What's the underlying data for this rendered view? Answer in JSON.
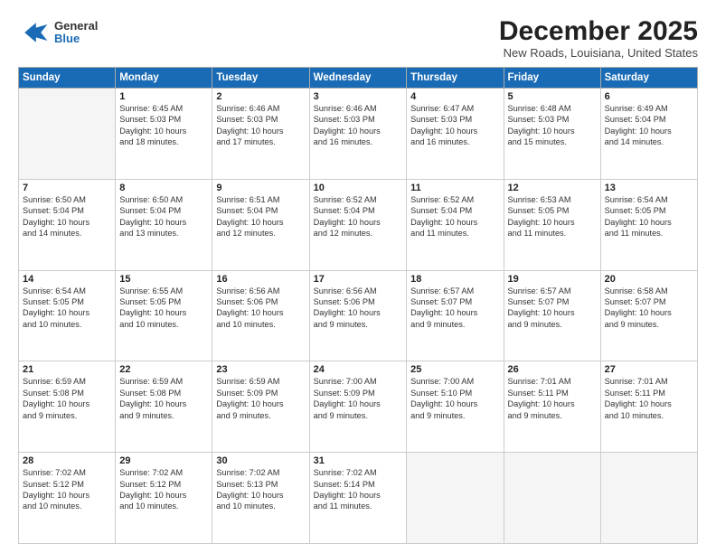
{
  "header": {
    "logo": {
      "general": "General",
      "blue": "Blue"
    },
    "title": "December 2025",
    "location": "New Roads, Louisiana, United States"
  },
  "days_of_week": [
    "Sunday",
    "Monday",
    "Tuesday",
    "Wednesday",
    "Thursday",
    "Friday",
    "Saturday"
  ],
  "weeks": [
    [
      {
        "day": "",
        "info": ""
      },
      {
        "day": "1",
        "info": "Sunrise: 6:45 AM\nSunset: 5:03 PM\nDaylight: 10 hours\nand 18 minutes."
      },
      {
        "day": "2",
        "info": "Sunrise: 6:46 AM\nSunset: 5:03 PM\nDaylight: 10 hours\nand 17 minutes."
      },
      {
        "day": "3",
        "info": "Sunrise: 6:46 AM\nSunset: 5:03 PM\nDaylight: 10 hours\nand 16 minutes."
      },
      {
        "day": "4",
        "info": "Sunrise: 6:47 AM\nSunset: 5:03 PM\nDaylight: 10 hours\nand 16 minutes."
      },
      {
        "day": "5",
        "info": "Sunrise: 6:48 AM\nSunset: 5:03 PM\nDaylight: 10 hours\nand 15 minutes."
      },
      {
        "day": "6",
        "info": "Sunrise: 6:49 AM\nSunset: 5:04 PM\nDaylight: 10 hours\nand 14 minutes."
      }
    ],
    [
      {
        "day": "7",
        "info": "Sunrise: 6:50 AM\nSunset: 5:04 PM\nDaylight: 10 hours\nand 14 minutes."
      },
      {
        "day": "8",
        "info": "Sunrise: 6:50 AM\nSunset: 5:04 PM\nDaylight: 10 hours\nand 13 minutes."
      },
      {
        "day": "9",
        "info": "Sunrise: 6:51 AM\nSunset: 5:04 PM\nDaylight: 10 hours\nand 12 minutes."
      },
      {
        "day": "10",
        "info": "Sunrise: 6:52 AM\nSunset: 5:04 PM\nDaylight: 10 hours\nand 12 minutes."
      },
      {
        "day": "11",
        "info": "Sunrise: 6:52 AM\nSunset: 5:04 PM\nDaylight: 10 hours\nand 11 minutes."
      },
      {
        "day": "12",
        "info": "Sunrise: 6:53 AM\nSunset: 5:05 PM\nDaylight: 10 hours\nand 11 minutes."
      },
      {
        "day": "13",
        "info": "Sunrise: 6:54 AM\nSunset: 5:05 PM\nDaylight: 10 hours\nand 11 minutes."
      }
    ],
    [
      {
        "day": "14",
        "info": "Sunrise: 6:54 AM\nSunset: 5:05 PM\nDaylight: 10 hours\nand 10 minutes."
      },
      {
        "day": "15",
        "info": "Sunrise: 6:55 AM\nSunset: 5:05 PM\nDaylight: 10 hours\nand 10 minutes."
      },
      {
        "day": "16",
        "info": "Sunrise: 6:56 AM\nSunset: 5:06 PM\nDaylight: 10 hours\nand 10 minutes."
      },
      {
        "day": "17",
        "info": "Sunrise: 6:56 AM\nSunset: 5:06 PM\nDaylight: 10 hours\nand 9 minutes."
      },
      {
        "day": "18",
        "info": "Sunrise: 6:57 AM\nSunset: 5:07 PM\nDaylight: 10 hours\nand 9 minutes."
      },
      {
        "day": "19",
        "info": "Sunrise: 6:57 AM\nSunset: 5:07 PM\nDaylight: 10 hours\nand 9 minutes."
      },
      {
        "day": "20",
        "info": "Sunrise: 6:58 AM\nSunset: 5:07 PM\nDaylight: 10 hours\nand 9 minutes."
      }
    ],
    [
      {
        "day": "21",
        "info": "Sunrise: 6:59 AM\nSunset: 5:08 PM\nDaylight: 10 hours\nand 9 minutes."
      },
      {
        "day": "22",
        "info": "Sunrise: 6:59 AM\nSunset: 5:08 PM\nDaylight: 10 hours\nand 9 minutes."
      },
      {
        "day": "23",
        "info": "Sunrise: 6:59 AM\nSunset: 5:09 PM\nDaylight: 10 hours\nand 9 minutes."
      },
      {
        "day": "24",
        "info": "Sunrise: 7:00 AM\nSunset: 5:09 PM\nDaylight: 10 hours\nand 9 minutes."
      },
      {
        "day": "25",
        "info": "Sunrise: 7:00 AM\nSunset: 5:10 PM\nDaylight: 10 hours\nand 9 minutes."
      },
      {
        "day": "26",
        "info": "Sunrise: 7:01 AM\nSunset: 5:11 PM\nDaylight: 10 hours\nand 9 minutes."
      },
      {
        "day": "27",
        "info": "Sunrise: 7:01 AM\nSunset: 5:11 PM\nDaylight: 10 hours\nand 10 minutes."
      }
    ],
    [
      {
        "day": "28",
        "info": "Sunrise: 7:02 AM\nSunset: 5:12 PM\nDaylight: 10 hours\nand 10 minutes."
      },
      {
        "day": "29",
        "info": "Sunrise: 7:02 AM\nSunset: 5:12 PM\nDaylight: 10 hours\nand 10 minutes."
      },
      {
        "day": "30",
        "info": "Sunrise: 7:02 AM\nSunset: 5:13 PM\nDaylight: 10 hours\nand 10 minutes."
      },
      {
        "day": "31",
        "info": "Sunrise: 7:02 AM\nSunset: 5:14 PM\nDaylight: 10 hours\nand 11 minutes."
      },
      {
        "day": "",
        "info": ""
      },
      {
        "day": "",
        "info": ""
      },
      {
        "day": "",
        "info": ""
      }
    ]
  ]
}
